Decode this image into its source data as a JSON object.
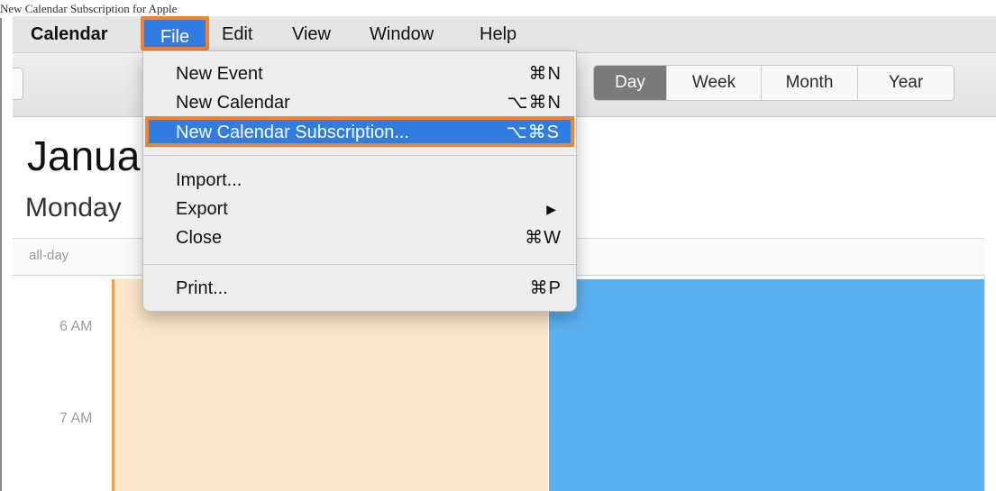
{
  "caption": "New Calendar Subscription for Apple",
  "menubar": {
    "app": "Calendar",
    "items": [
      "File",
      "Edit",
      "View",
      "Window",
      "Help"
    ]
  },
  "toolbar": {
    "views": [
      "Day",
      "Week",
      "Month",
      "Year"
    ],
    "selected_view": "Day"
  },
  "header": {
    "month_partial": "Janua",
    "weekday_partial": "Monday"
  },
  "calendar": {
    "allday_label": "all-day",
    "time_labels": [
      "6 AM",
      "7 AM"
    ]
  },
  "file_menu": {
    "items": [
      {
        "label": "New Event",
        "shortcut": "⌘N"
      },
      {
        "label": "New Calendar",
        "shortcut": "⌥⌘N"
      },
      {
        "label": "New Calendar Subscription...",
        "shortcut": "⌥⌘S"
      },
      {
        "label": "Import...",
        "shortcut": ""
      },
      {
        "label": "Export",
        "shortcut": "▶"
      },
      {
        "label": "Close",
        "shortcut": "⌘W"
      },
      {
        "label": "Print...",
        "shortcut": "⌘P"
      }
    ]
  },
  "colors": {
    "highlight_blue": "#2f7de1",
    "annotation_orange": "#f08236",
    "event_peach": "#fae6c9",
    "event_blue": "#5bb1f0"
  }
}
